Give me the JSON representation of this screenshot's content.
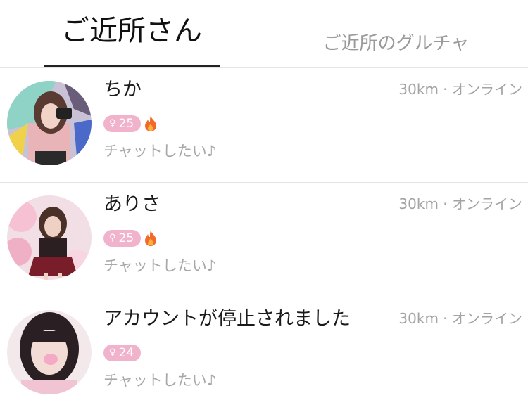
{
  "tabs": {
    "active_label": "ご近所さん",
    "inactive_label": "ご近所のグルチャ"
  },
  "users": [
    {
      "name": "ちか",
      "meta": "30km · オンライン",
      "age": "25",
      "gender_icon": "female-symbol-icon",
      "hot": true,
      "message": "チャットしたい♪"
    },
    {
      "name": "ありさ",
      "meta": "30km · オンライン",
      "age": "25",
      "gender_icon": "female-symbol-icon",
      "hot": true,
      "message": "チャットしたい♪"
    },
    {
      "name": "アカウントが停止されました",
      "meta": "30km · オンライン",
      "age": "24",
      "gender_icon": "female-symbol-icon",
      "hot": false,
      "message": "チャットしたい♪"
    }
  ],
  "colors": {
    "age_badge": "#f0b3cb",
    "flame_outer": "#f26a2a",
    "flame_inner": "#fbb13c",
    "divider": "#e4e4e4",
    "muted_text": "#a3a3a3"
  }
}
